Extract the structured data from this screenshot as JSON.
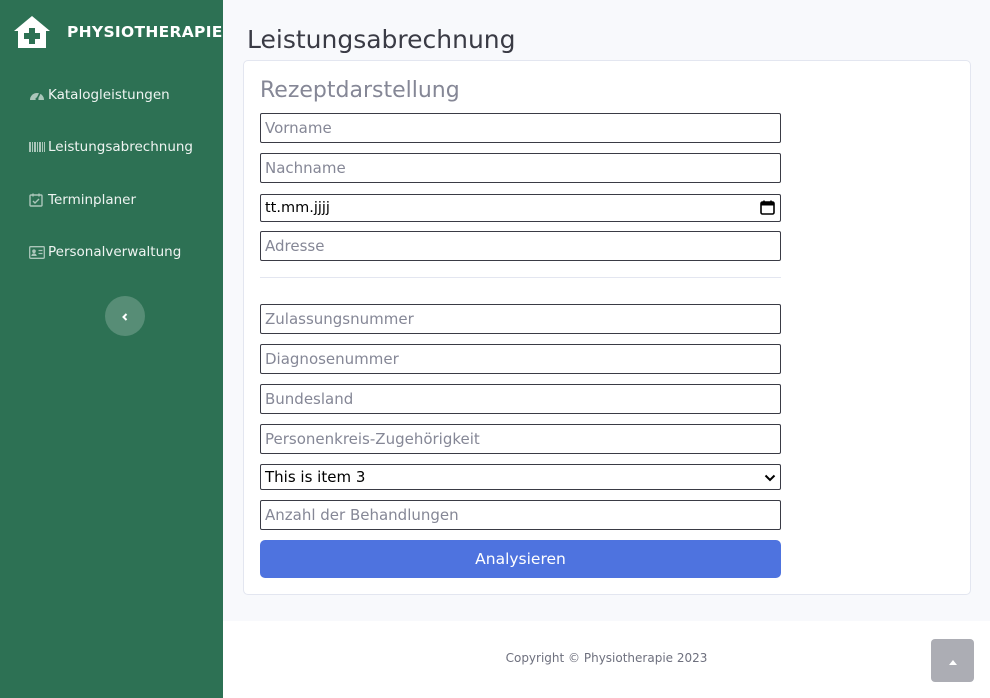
{
  "brand": {
    "name": "PHYSIOTHERAPIE",
    "icon": "house-medical-icon"
  },
  "sidebar": {
    "items": [
      {
        "label": "Katalogleistungen",
        "icon": "gauge-icon"
      },
      {
        "label": "Leistungsabrechnung",
        "icon": "barcode-icon"
      },
      {
        "label": "Terminplaner",
        "icon": "calendar-check-icon"
      },
      {
        "label": "Personalverwaltung",
        "icon": "id-card-icon"
      }
    ],
    "toggle_icon": "chevron-left-icon"
  },
  "page": {
    "title": "Leistungsabrechnung"
  },
  "form": {
    "title": "Rezeptdarstellung",
    "vorname_placeholder": "Vorname",
    "nachname_placeholder": "Nachname",
    "date_placeholder": "tt.mm.jjjj",
    "adresse_placeholder": "Adresse",
    "zulassung_placeholder": "Zulassungsnummer",
    "diagnose_placeholder": "Diagnosenummer",
    "bundesland_placeholder": "Bundesland",
    "personenkreis_placeholder": "Personenkreis-Zugehörigkeit",
    "select_value": "This is item 3",
    "anzahl_placeholder": "Anzahl der Behandlungen",
    "submit_label": "Analysieren"
  },
  "footer": {
    "copyright": "Copyright © Physiotherapie 2023"
  },
  "scroll_top_icon": "chevron-up-icon",
  "colors": {
    "sidebar": "#2d7154",
    "primary": "#4e73df",
    "background": "#f8f9fc"
  }
}
